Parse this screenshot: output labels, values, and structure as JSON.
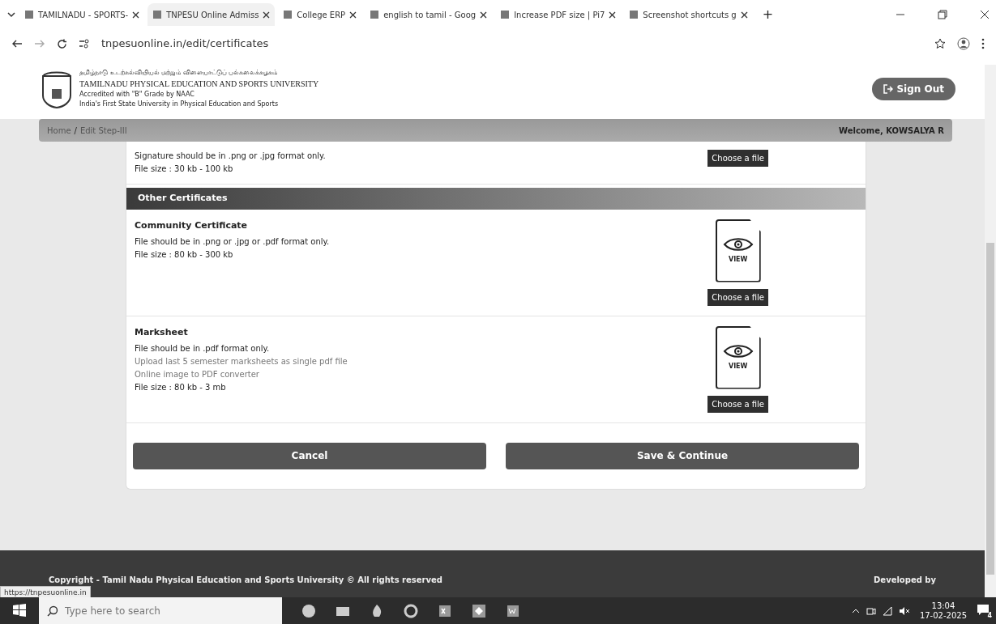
{
  "browser": {
    "tabs": [
      {
        "title": "TAMILNADU - SPORTS-",
        "selected": false
      },
      {
        "title": "TNPESU Online Admiss",
        "selected": true
      },
      {
        "title": "College ERP",
        "selected": false
      },
      {
        "title": "english to tamil - Goog",
        "selected": false
      },
      {
        "title": "Increase PDF size | Pi7",
        "selected": false
      },
      {
        "title": "Screenshot shortcuts g",
        "selected": false
      }
    ],
    "new_tab": "+",
    "url": "tnpesuonline.in/edit/certificates",
    "status_url": "https://tnpesuonline.in"
  },
  "header": {
    "tamil_name": "தமிழ்நாடு உடற்கல்வியியல் மற்றும் விளையாட்டுப் பல்கலைக்கழகம்",
    "name": "TAMILNADU PHYSICAL EDUCATION AND SPORTS UNIVERSITY",
    "accreditation": "Accredited with \"B\" Grade by NAAC",
    "tagline": "India's First State University in Physical Education and Sports",
    "sign_out": "Sign Out"
  },
  "breadcrumb": {
    "items": [
      "Home",
      "Edit Step-III"
    ],
    "separator": "/",
    "welcome": "Welcome, KOWSALYA R"
  },
  "sections": [
    {
      "kind": "upload",
      "lines": [
        {
          "text": "Signature should be in .png or .jpg format only.",
          "muted": false
        },
        {
          "text": "File size : 30 kb - 100 kb",
          "muted": false
        }
      ],
      "button": "Choose a file"
    },
    {
      "kind": "header",
      "title": "Other Certificates"
    },
    {
      "kind": "upload",
      "title": "Community Certificate",
      "lines": [
        {
          "text": "File should be in .png or .jpg or .pdf format only.",
          "muted": false
        },
        {
          "text": "File size : 80 kb - 300 kb",
          "muted": false
        }
      ],
      "view": "VIEW",
      "button": "Choose a file"
    },
    {
      "kind": "upload",
      "title": "Marksheet",
      "lines": [
        {
          "text": "File should be in .pdf format only.",
          "muted": false
        },
        {
          "text": "Upload last 5 semester marksheets as single pdf file",
          "muted": true
        },
        {
          "text": "Online image to PDF converter",
          "muted": true
        },
        {
          "text": "File size : 80 kb - 3 mb",
          "muted": false
        }
      ],
      "view": "VIEW",
      "button": "Choose a file"
    }
  ],
  "actions": [
    "Cancel",
    "Save & Continue"
  ],
  "footer": {
    "copyright": "Copyright - Tamil Nadu Physical Education and Sports University © All rights reserved",
    "developed": "Developed by"
  },
  "taskbar": {
    "search_placeholder": "Type here to search",
    "time": "13:04",
    "date": "17-02-2025",
    "notifications": "4"
  }
}
